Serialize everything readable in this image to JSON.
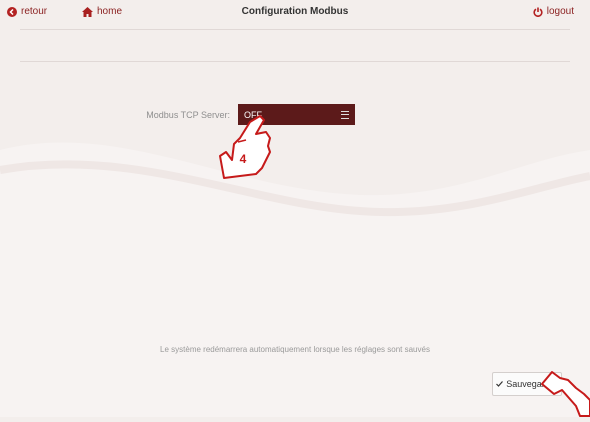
{
  "topbar": {
    "back_label": "retour",
    "home_label": "home",
    "title": "Configuration Modbus",
    "logout_label": "logout"
  },
  "form": {
    "modbus_label": "Modbus TCP Server:",
    "modbus_value": "OFF"
  },
  "annotation": {
    "step_number": "4"
  },
  "footer": {
    "notice": "Le système redémarrera automatiquement lorsque les réglages sont sauvés",
    "save_label": "Sauvegarder"
  },
  "colors": {
    "accent": "#8a1f1f",
    "select_bg": "#5c1a1a",
    "background": "#f3eeec"
  },
  "icons": {
    "back": "arrow-left-circle-icon",
    "home": "home-icon",
    "logout": "power-icon",
    "menu": "menu-icon",
    "check": "check-icon",
    "pointer": "hand-pointer-icon"
  }
}
